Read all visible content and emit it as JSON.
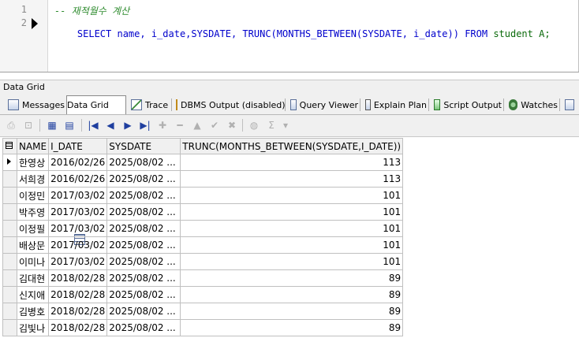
{
  "editor": {
    "lines": [
      {
        "n": "1",
        "comment": "-- 재적월수 계산"
      },
      {
        "n": "2",
        "parts": [
          {
            "t": "SELECT ",
            "c": "kw"
          },
          {
            "t": "name, i_date,SYSDATE, TRUNC(MONTHS_BETWEEN(SYSDATE, i_date)) ",
            "c": "id"
          },
          {
            "t": "FROM ",
            "c": "kw"
          },
          {
            "t": "student A;",
            "c": "tx"
          }
        ]
      }
    ]
  },
  "panel_title": "Data Grid",
  "tabs": [
    {
      "label": "Messages",
      "icon": "messages-icon",
      "active": false
    },
    {
      "label": "Data Grid",
      "icon": "data-grid-icon",
      "active": true
    },
    {
      "label": "Trace",
      "icon": "trace-icon",
      "active": false
    },
    {
      "label": "DBMS Output (disabled)",
      "icon": "dbms-output-icon",
      "active": false
    },
    {
      "label": "Query Viewer",
      "icon": "query-viewer-icon",
      "active": false
    },
    {
      "label": "Explain Plan",
      "icon": "explain-plan-icon",
      "active": false
    },
    {
      "label": "Script Output",
      "icon": "script-output-icon",
      "active": false
    },
    {
      "label": "Watches",
      "icon": "watches-icon",
      "active": false
    }
  ],
  "toolbar_icons": [
    {
      "name": "print-icon",
      "glyph": "⎙",
      "disabled": true
    },
    {
      "name": "lock-icon",
      "glyph": "⊡",
      "disabled": true
    },
    {
      "name": "refresh-grid-icon",
      "glyph": "▦",
      "disabled": false
    },
    {
      "name": "export-grid-icon",
      "glyph": "▤",
      "disabled": false
    },
    {
      "name": "first-record-icon",
      "glyph": "|◀",
      "disabled": false
    },
    {
      "name": "prior-record-icon",
      "glyph": "◀",
      "disabled": false
    },
    {
      "name": "next-record-icon",
      "glyph": "▶",
      "disabled": false
    },
    {
      "name": "last-record-icon",
      "glyph": "▶|",
      "disabled": false
    },
    {
      "name": "insert-record-icon",
      "glyph": "✚",
      "disabled": true
    },
    {
      "name": "delete-record-icon",
      "glyph": "━",
      "disabled": true
    },
    {
      "name": "edit-record-icon",
      "glyph": "▲",
      "disabled": true
    },
    {
      "name": "post-edit-icon",
      "glyph": "✔",
      "disabled": true
    },
    {
      "name": "cancel-edit-icon",
      "glyph": "✖",
      "disabled": true
    },
    {
      "name": "filter-icon",
      "glyph": "◍",
      "disabled": true
    },
    {
      "name": "sum-icon",
      "glyph": "Σ",
      "disabled": true
    },
    {
      "name": "dropdown-icon",
      "glyph": "▾",
      "disabled": true
    }
  ],
  "grid": {
    "columns": [
      "NAME",
      "I_DATE",
      "SYSDATE",
      "TRUNC(MONTHS_BETWEEN(SYSDATE,I_DATE))"
    ],
    "rows": [
      [
        "한영상",
        "2016/02/26",
        "2025/08/02 ...",
        "113"
      ],
      [
        "서희경",
        "2016/02/26",
        "2025/08/02 ...",
        "113"
      ],
      [
        "이정민",
        "2017/03/02",
        "2025/08/02 ...",
        "101"
      ],
      [
        "박주영",
        "2017/03/02",
        "2025/08/02 ...",
        "101"
      ],
      [
        "이정필",
        "2017/03/02",
        "2025/08/02 ...",
        "101"
      ],
      [
        "배상문",
        "2017/03/02",
        "2025/08/02 ...",
        "101"
      ],
      [
        "이미나",
        "2017/03/02",
        "2025/08/02 ...",
        "101"
      ],
      [
        "김대현",
        "2018/02/28",
        "2025/08/02 ...",
        "89"
      ],
      [
        "신지애",
        "2018/02/28",
        "2025/08/02 ...",
        "89"
      ],
      [
        "김병호",
        "2018/02/28",
        "2025/08/02 ...",
        "89"
      ],
      [
        "김빛나",
        "2018/02/28",
        "2025/08/02 ...",
        "89"
      ]
    ]
  }
}
